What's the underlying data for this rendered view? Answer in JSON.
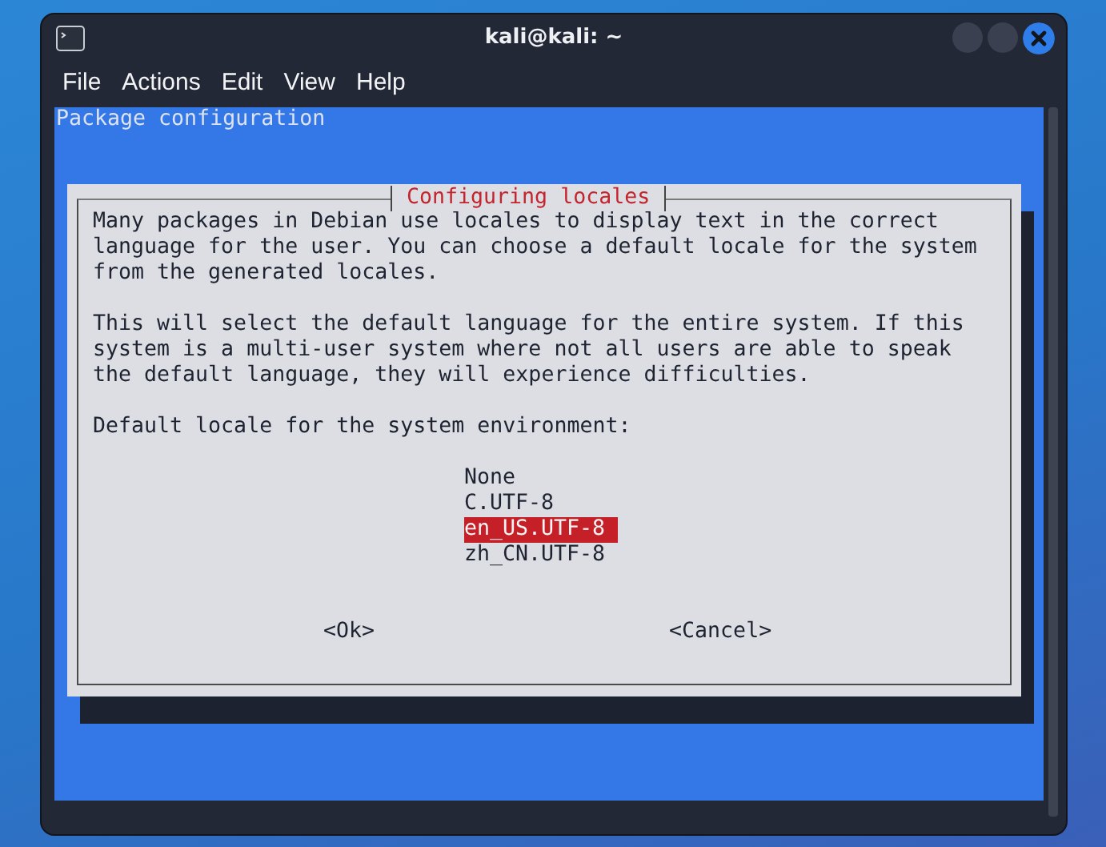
{
  "window": {
    "title": "kali@kali: ~"
  },
  "menu": [
    {
      "label": "File"
    },
    {
      "label": "Actions"
    },
    {
      "label": "Edit"
    },
    {
      "label": "View"
    },
    {
      "label": "Help"
    }
  ],
  "terminal": {
    "header": "Package configuration",
    "dialog": {
      "title": "Configuring locales",
      "paragraphs": [
        [
          "Many packages in Debian use locales to display text in the correct",
          "language for the user. You can choose a default locale for the system",
          "from the generated locales."
        ],
        [
          "This will select the default language for the entire system. If this",
          "system is a multi-user system where not all users are able to speak",
          "the default language, they will experience difficulties."
        ],
        [
          "Default locale for the system environment:"
        ]
      ],
      "options": [
        {
          "label": "None",
          "selected": false
        },
        {
          "label": "C.UTF-8",
          "selected": false
        },
        {
          "label": "en_US.UTF-8",
          "selected": true
        },
        {
          "label": "zh_CN.UTF-8",
          "selected": false
        }
      ],
      "buttons": [
        "<Ok>",
        "<Cancel>"
      ]
    }
  }
}
